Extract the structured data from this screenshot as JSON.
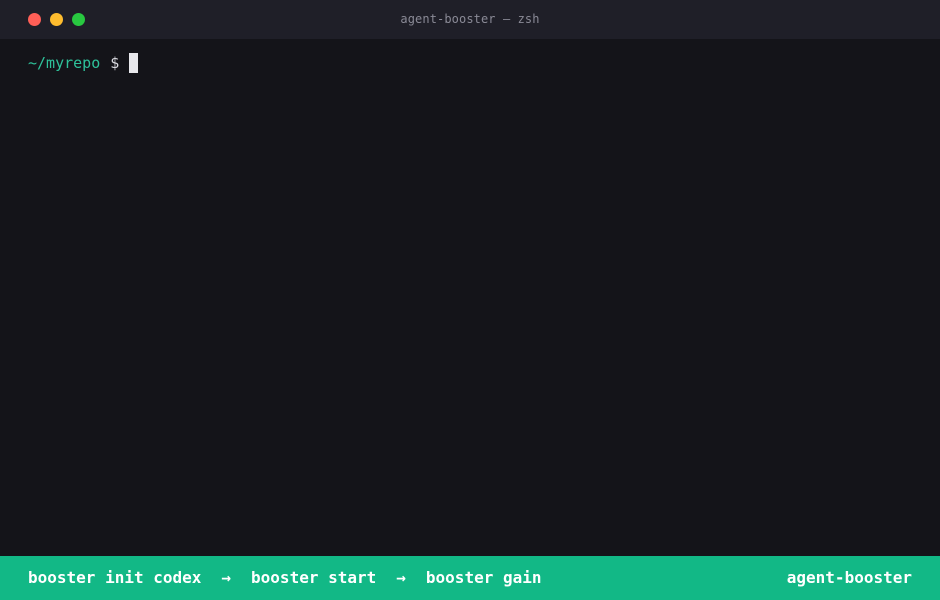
{
  "window": {
    "title": "agent-booster — zsh"
  },
  "terminal": {
    "cwd": "~/myrepo",
    "prompt_symbol": "$"
  },
  "statusbar": {
    "steps": [
      "booster init codex",
      "booster start",
      "booster gain"
    ],
    "separator": "→",
    "brand": "agent-booster"
  },
  "colors": {
    "accent": "#12b886",
    "terminal_bg": "#141419",
    "cwd": "#2ec29a"
  }
}
